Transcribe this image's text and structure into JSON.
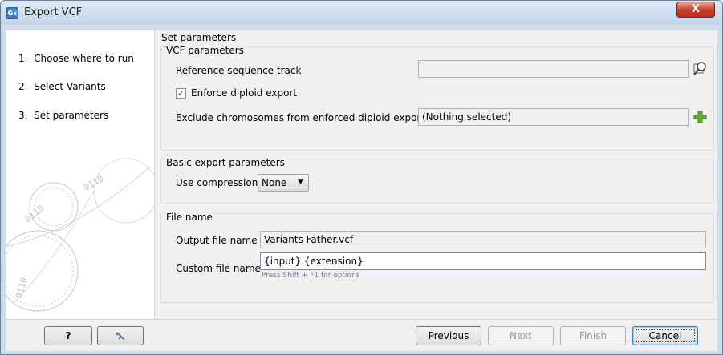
{
  "window": {
    "title": "Export VCF",
    "app_icon_text": "Gx",
    "close_symbol": "X"
  },
  "steps": [
    {
      "number": "1.",
      "label": "Choose where to run"
    },
    {
      "number": "2.",
      "label": "Select Variants"
    },
    {
      "number": "3.",
      "label": "Set parameters"
    }
  ],
  "main": {
    "section_title": "Set parameters",
    "vcf_group": {
      "title": "VCF parameters",
      "reference_label": "Reference sequence track",
      "reference_value": "",
      "enforce_diploid_label": "Enforce diploid export",
      "enforce_diploid_checked": true,
      "exclude_label": "Exclude chromosomes from enforced diploid export",
      "exclude_value": "(Nothing selected)"
    },
    "basic_group": {
      "title": "Basic export parameters",
      "compression_label": "Use compression",
      "compression_value": "None"
    },
    "file_group": {
      "title": "File name",
      "output_label": "Output file name",
      "output_value": "Variants Father.vcf",
      "custom_label": "Custom file name",
      "custom_value": "{input}.{extension}",
      "custom_hint": "Press Shift + F1 for options"
    }
  },
  "buttons": {
    "help": "?",
    "reset_icon": "reset-icon",
    "previous": "Previous",
    "next": "Next",
    "finish": "Finish",
    "cancel": "Cancel"
  },
  "colors": {
    "frame": "#cfdcea",
    "close_red": "#c8412a",
    "plus_green": "#4a9a2a",
    "panel": "#f0f0f0"
  }
}
